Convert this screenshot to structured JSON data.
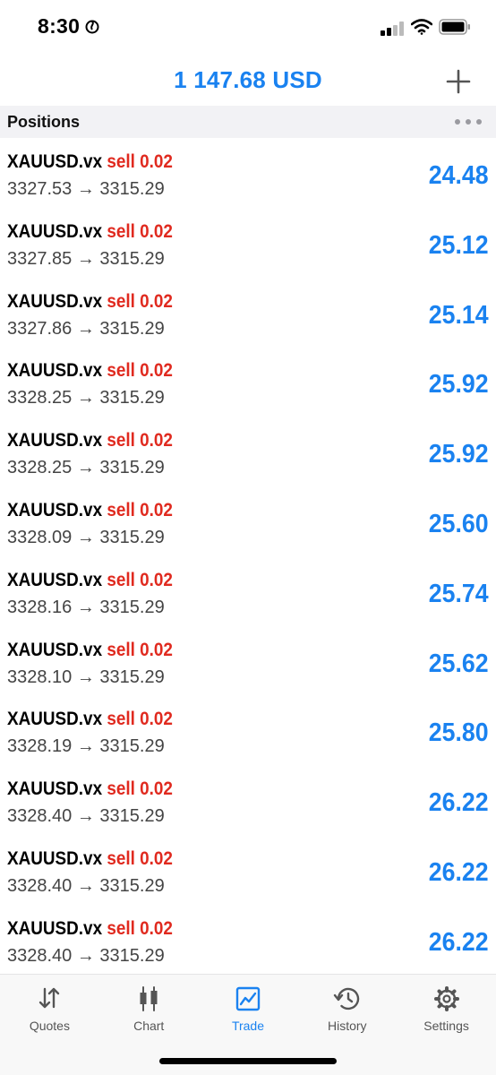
{
  "status_bar": {
    "time": "8:30"
  },
  "header": {
    "balance": "1 147.68 USD"
  },
  "section": {
    "title": "Positions"
  },
  "positions": [
    {
      "symbol": "XAUUSD.vx",
      "side": "sell",
      "volume": "0.02",
      "open_price": "3327.53",
      "arrow": "→",
      "current_price": "3315.29",
      "profit": "24.48"
    },
    {
      "symbol": "XAUUSD.vx",
      "side": "sell",
      "volume": "0.02",
      "open_price": "3327.85",
      "arrow": "→",
      "current_price": "3315.29",
      "profit": "25.12"
    },
    {
      "symbol": "XAUUSD.vx",
      "side": "sell",
      "volume": "0.02",
      "open_price": "3327.86",
      "arrow": "→",
      "current_price": "3315.29",
      "profit": "25.14"
    },
    {
      "symbol": "XAUUSD.vx",
      "side": "sell",
      "volume": "0.02",
      "open_price": "3328.25",
      "arrow": "→",
      "current_price": "3315.29",
      "profit": "25.92"
    },
    {
      "symbol": "XAUUSD.vx",
      "side": "sell",
      "volume": "0.02",
      "open_price": "3328.25",
      "arrow": "→",
      "current_price": "3315.29",
      "profit": "25.92"
    },
    {
      "symbol": "XAUUSD.vx",
      "side": "sell",
      "volume": "0.02",
      "open_price": "3328.09",
      "arrow": "→",
      "current_price": "3315.29",
      "profit": "25.60"
    },
    {
      "symbol": "XAUUSD.vx",
      "side": "sell",
      "volume": "0.02",
      "open_price": "3328.16",
      "arrow": "→",
      "current_price": "3315.29",
      "profit": "25.74"
    },
    {
      "symbol": "XAUUSD.vx",
      "side": "sell",
      "volume": "0.02",
      "open_price": "3328.10",
      "arrow": "→",
      "current_price": "3315.29",
      "profit": "25.62"
    },
    {
      "symbol": "XAUUSD.vx",
      "side": "sell",
      "volume": "0.02",
      "open_price": "3328.19",
      "arrow": "→",
      "current_price": "3315.29",
      "profit": "25.80"
    },
    {
      "symbol": "XAUUSD.vx",
      "side": "sell",
      "volume": "0.02",
      "open_price": "3328.40",
      "arrow": "→",
      "current_price": "3315.29",
      "profit": "26.22"
    },
    {
      "symbol": "XAUUSD.vx",
      "side": "sell",
      "volume": "0.02",
      "open_price": "3328.40",
      "arrow": "→",
      "current_price": "3315.29",
      "profit": "26.22"
    },
    {
      "symbol": "XAUUSD.vx",
      "side": "sell",
      "volume": "0.02",
      "open_price": "3328.40",
      "arrow": "→",
      "current_price": "3315.29",
      "profit": "26.22"
    }
  ],
  "tabs": [
    {
      "label": "Quotes",
      "icon": "quotes-icon",
      "active": false
    },
    {
      "label": "Chart",
      "icon": "chart-icon",
      "active": false
    },
    {
      "label": "Trade",
      "icon": "trade-icon",
      "active": true
    },
    {
      "label": "History",
      "icon": "history-icon",
      "active": false
    },
    {
      "label": "Settings",
      "icon": "settings-icon",
      "active": false
    }
  ],
  "colors": {
    "accent": "#1a82f0",
    "sell": "#e02a1f",
    "section_bg": "#f2f2f5"
  }
}
